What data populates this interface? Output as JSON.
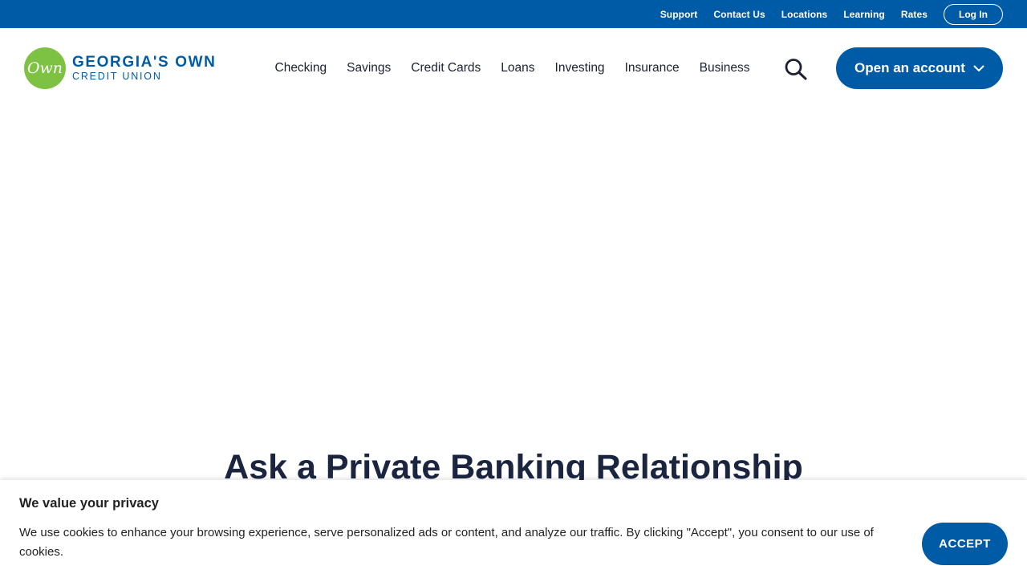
{
  "utility_nav": {
    "links": [
      "Support",
      "Contact Us",
      "Locations",
      "Learning",
      "Rates"
    ],
    "login_label": "Log In"
  },
  "logo": {
    "mark": "Own",
    "line1": "GEORGIA'S OWN",
    "line2": "CREDIT UNION"
  },
  "primary_nav": {
    "items": [
      "Checking",
      "Savings",
      "Credit Cards",
      "Loans",
      "Investing",
      "Insurance",
      "Business"
    ]
  },
  "header": {
    "search_icon": "search-icon",
    "open_account_label": "Open an account",
    "open_account_icon": "chevron-down-icon"
  },
  "hero": {
    "heading": "Ask a Private Banking Relationship"
  },
  "cookie": {
    "title": "We value your privacy",
    "text": "We use cookies to enhance your browsing experience, serve personalized ads or content, and analyze our traffic. By clicking \"Accept\", you consent to our use of cookies.",
    "accept_label": "ACCEPT"
  },
  "colors": {
    "brand_blue": "#005ba6",
    "logo_green": "#7dc242",
    "text_dark": "#1b2033"
  }
}
